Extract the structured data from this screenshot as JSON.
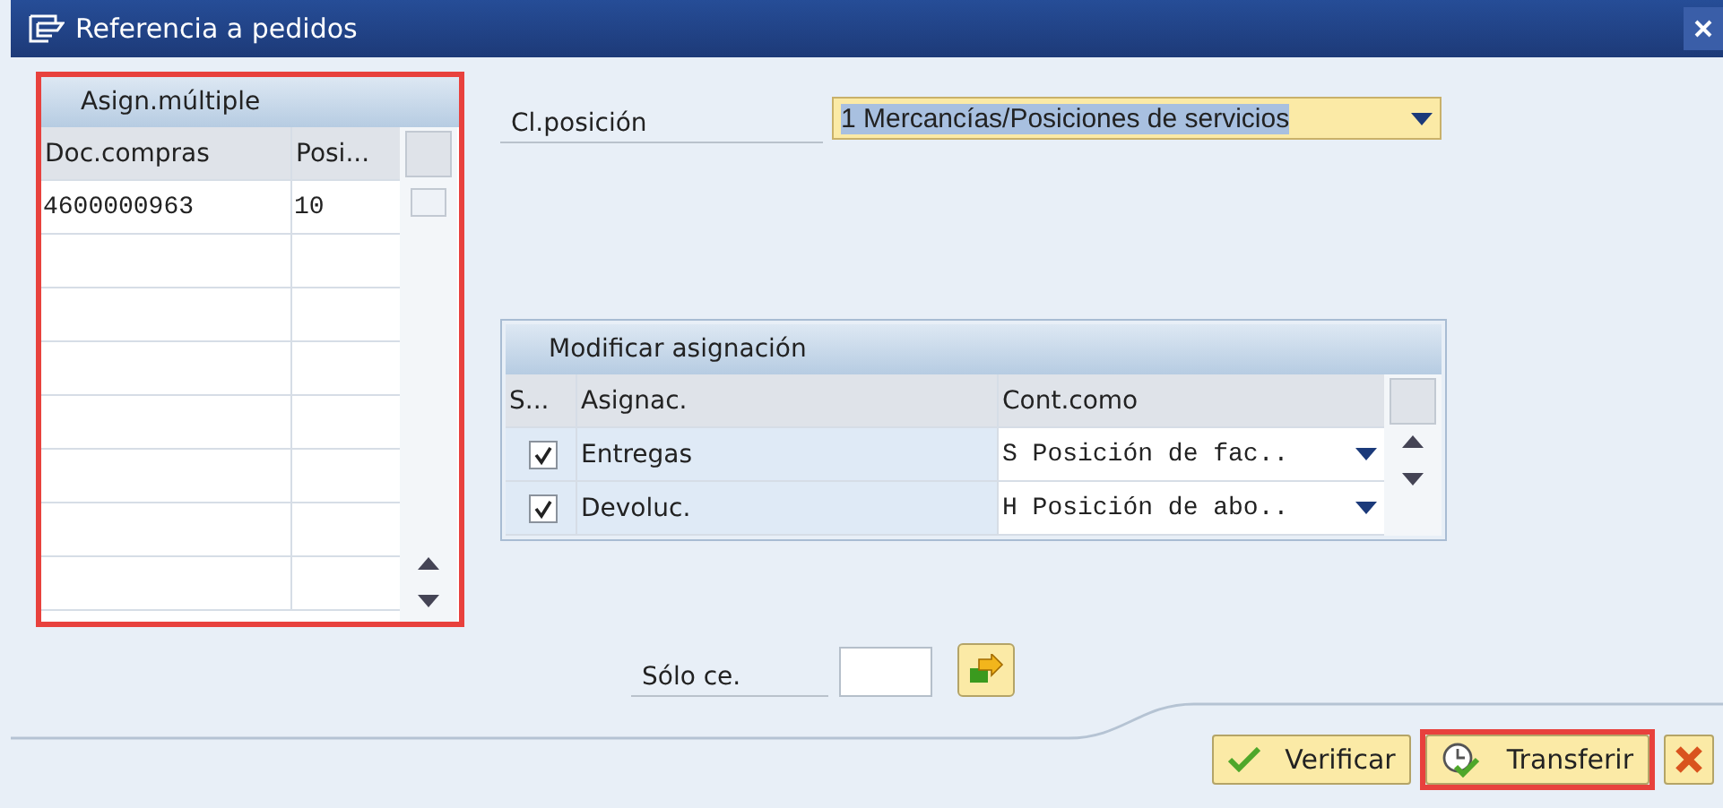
{
  "window": {
    "title": "Referencia a pedidos"
  },
  "multi_assign": {
    "title": "Asign.múltiple",
    "highlighted": true,
    "columns": [
      "Doc.compras",
      "Posi..."
    ],
    "rows": [
      {
        "cells": [
          "4600000963",
          "10"
        ]
      }
    ]
  },
  "item_category": {
    "label": "Cl.posición",
    "value": "1 Mercancías/Posiciones de servicios",
    "selected": true
  },
  "modify_assign": {
    "title": "Modificar asignación",
    "columns": [
      "S...",
      "Asignac.",
      "Cont.como"
    ],
    "rows": [
      {
        "checked": true,
        "assignment": "Entregas",
        "value": "S Posición de fac.."
      },
      {
        "checked": true,
        "assignment": "Devoluc.",
        "value": "H Posición de abo.."
      }
    ]
  },
  "plant_only": {
    "label": "Sólo ce."
  },
  "buttons": [
    {
      "kind": "check",
      "label": "Verificar",
      "highlighted": false
    },
    {
      "kind": "transfer",
      "label": "Transferir",
      "highlighted": true
    },
    {
      "kind": "cancel",
      "highlighted": false
    }
  ]
}
